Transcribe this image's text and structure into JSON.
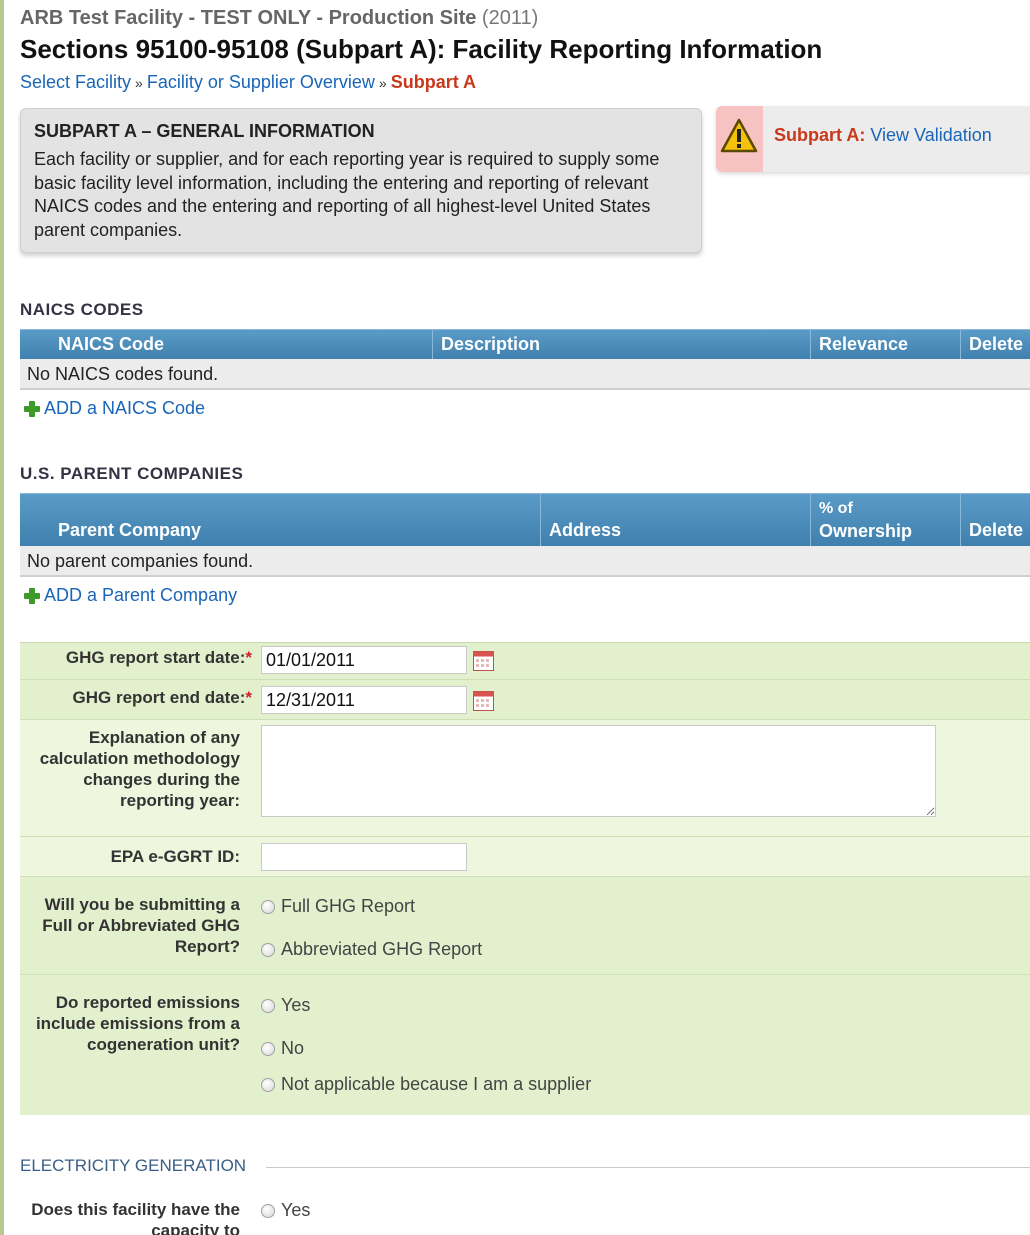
{
  "header": {
    "site_title": "ARB Test Facility - TEST ONLY - Production Site",
    "site_year": "(2011)",
    "page_title": "Sections 95100-95108 (Subpart A): Facility Reporting Information"
  },
  "breadcrumb": {
    "items": [
      "Select Facility",
      "Facility or Supplier Overview"
    ],
    "separator": "»",
    "current": "Subpart A"
  },
  "info_box": {
    "heading": "SUBPART A – GENERAL INFORMATION",
    "body": "Each facility or supplier, and for each reporting year is required to supply some basic facility level information, including the entering and reporting of relevant NAICS codes and the entering and reporting of all highest-level United States parent companies."
  },
  "validation": {
    "label": "Subpart A:",
    "link": "View Validation",
    "icon": "warning-icon"
  },
  "naics": {
    "heading": "NAICS CODES",
    "columns": [
      "NAICS Code",
      "Description",
      "Relevance",
      "Delete"
    ],
    "empty_text": "No NAICS codes found.",
    "add_label": "ADD a NAICS Code"
  },
  "parents": {
    "heading": "U.S. PARENT COMPANIES",
    "columns": [
      "Parent Company",
      "Address",
      "% of Ownership",
      "Delete"
    ],
    "col3_line1": "% of",
    "col3_line2": "Ownership",
    "empty_text": "No parent companies found.",
    "add_label": "ADD a Parent Company"
  },
  "form": {
    "start_date_label": "GHG report start date:",
    "start_date_value": "01/01/2011",
    "end_date_label": "GHG report end date:",
    "end_date_value": "12/31/2011",
    "required_mark": "*",
    "explanation_label": "Explanation of any calculation methodology changes during the reporting year:",
    "egrt_label": "EPA e-GGRT ID:",
    "egrt_value": "",
    "report_type_label": "Will you be submitting a Full or Abbreviated GHG Report?",
    "report_type_options": [
      "Full GHG Report",
      "Abbreviated GHG Report"
    ],
    "cogen_label": "Do reported emissions include emissions from a cogeneration unit?",
    "cogen_options": [
      "Yes",
      "No",
      "Not applicable because I am a supplier"
    ]
  },
  "electricity": {
    "legend": "ELECTRICITY GENERATION",
    "question_label": "Does this facility have the capacity to",
    "options": [
      "Yes"
    ]
  },
  "colors": {
    "link": "#1a65b8",
    "accent_red": "#c8391b",
    "grid_header": "#4a8cbb",
    "form_bg": "#eef6de"
  }
}
